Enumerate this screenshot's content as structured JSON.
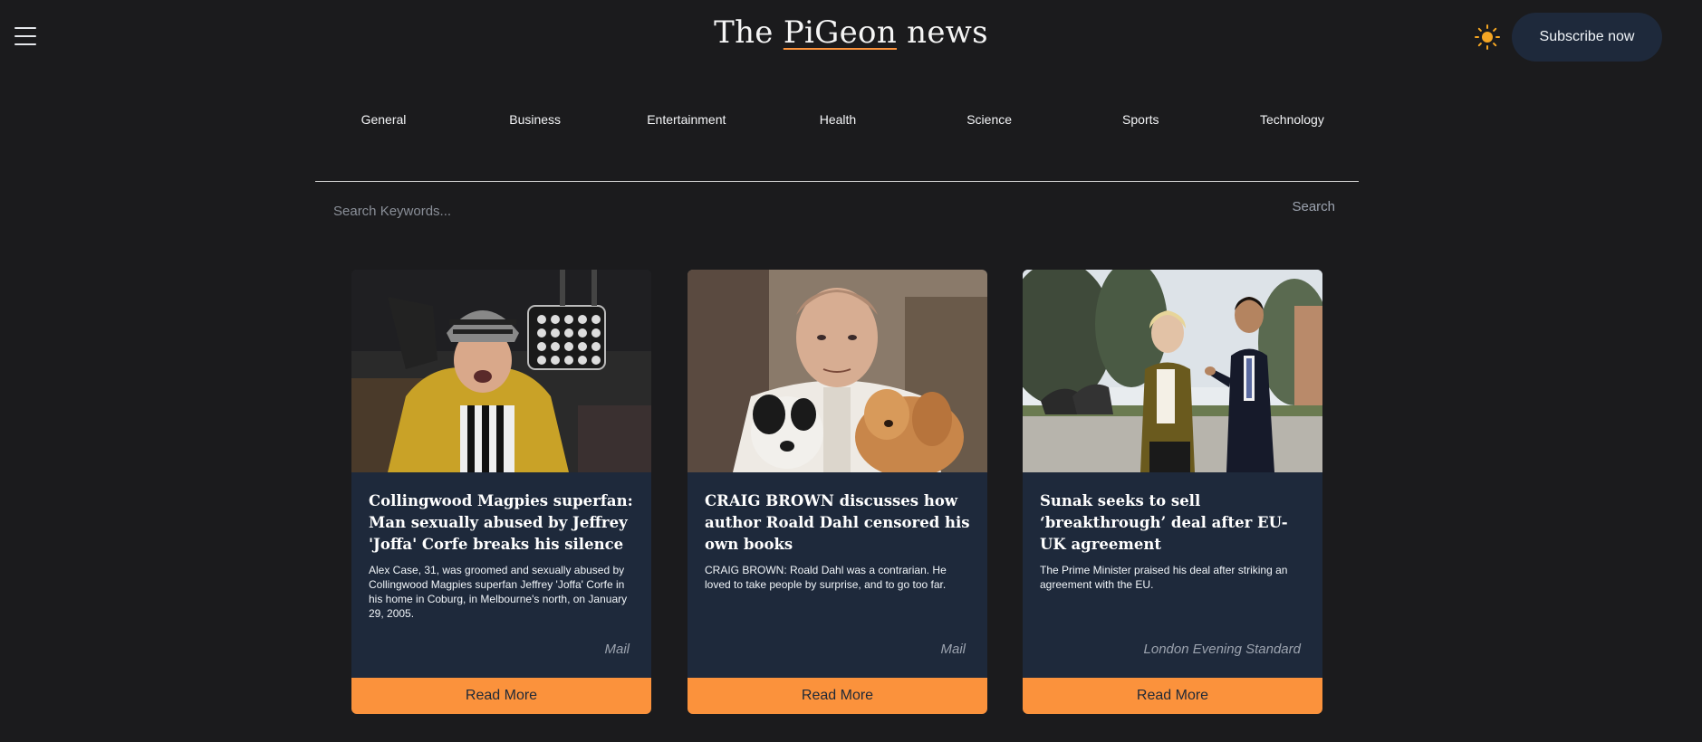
{
  "header": {
    "brand_prefix": "The ",
    "brand_accent": "PiGeon",
    "brand_suffix": " news",
    "subscribe_label": "Subscribe now"
  },
  "nav": {
    "items": [
      "General",
      "Business",
      "Entertainment",
      "Health",
      "Science",
      "Sports",
      "Technology"
    ]
  },
  "search": {
    "placeholder": "Search Keywords...",
    "button_label": "Search"
  },
  "articles": [
    {
      "title": "Collingwood Magpies superfan: Man sexually abused by Jeffrey 'Joffa' Corfe breaks his silence",
      "description": "Alex Case, 31, was groomed and sexually abused by Collingwood Magpies superfan Jeffrey 'Joffa' Corfe in his home in Coburg, in Melbourne's north, on January 29, 2005.",
      "source": "Mail",
      "button_label": "Read More"
    },
    {
      "title": "CRAIG BROWN discusses how author Roald Dahl censored his own books",
      "description": "CRAIG BROWN: Roald Dahl was a contrarian. He loved to take people by surprise, and to go too far.",
      "source": "Mail",
      "button_label": "Read More"
    },
    {
      "title": "Sunak seeks to sell ‘breakthrough’ deal after EU-UK agreement",
      "description": "The Prime Minister praised his deal after striking an agreement with the EU.",
      "source": "London Evening Standard",
      "button_label": "Read More"
    }
  ],
  "colors": {
    "background": "#1b1b1d",
    "card": "#1e293b",
    "accent": "#fb923c",
    "sun": "#f5a623"
  },
  "icons": {
    "menu": "hamburger-menu-icon",
    "theme": "sun-icon"
  }
}
